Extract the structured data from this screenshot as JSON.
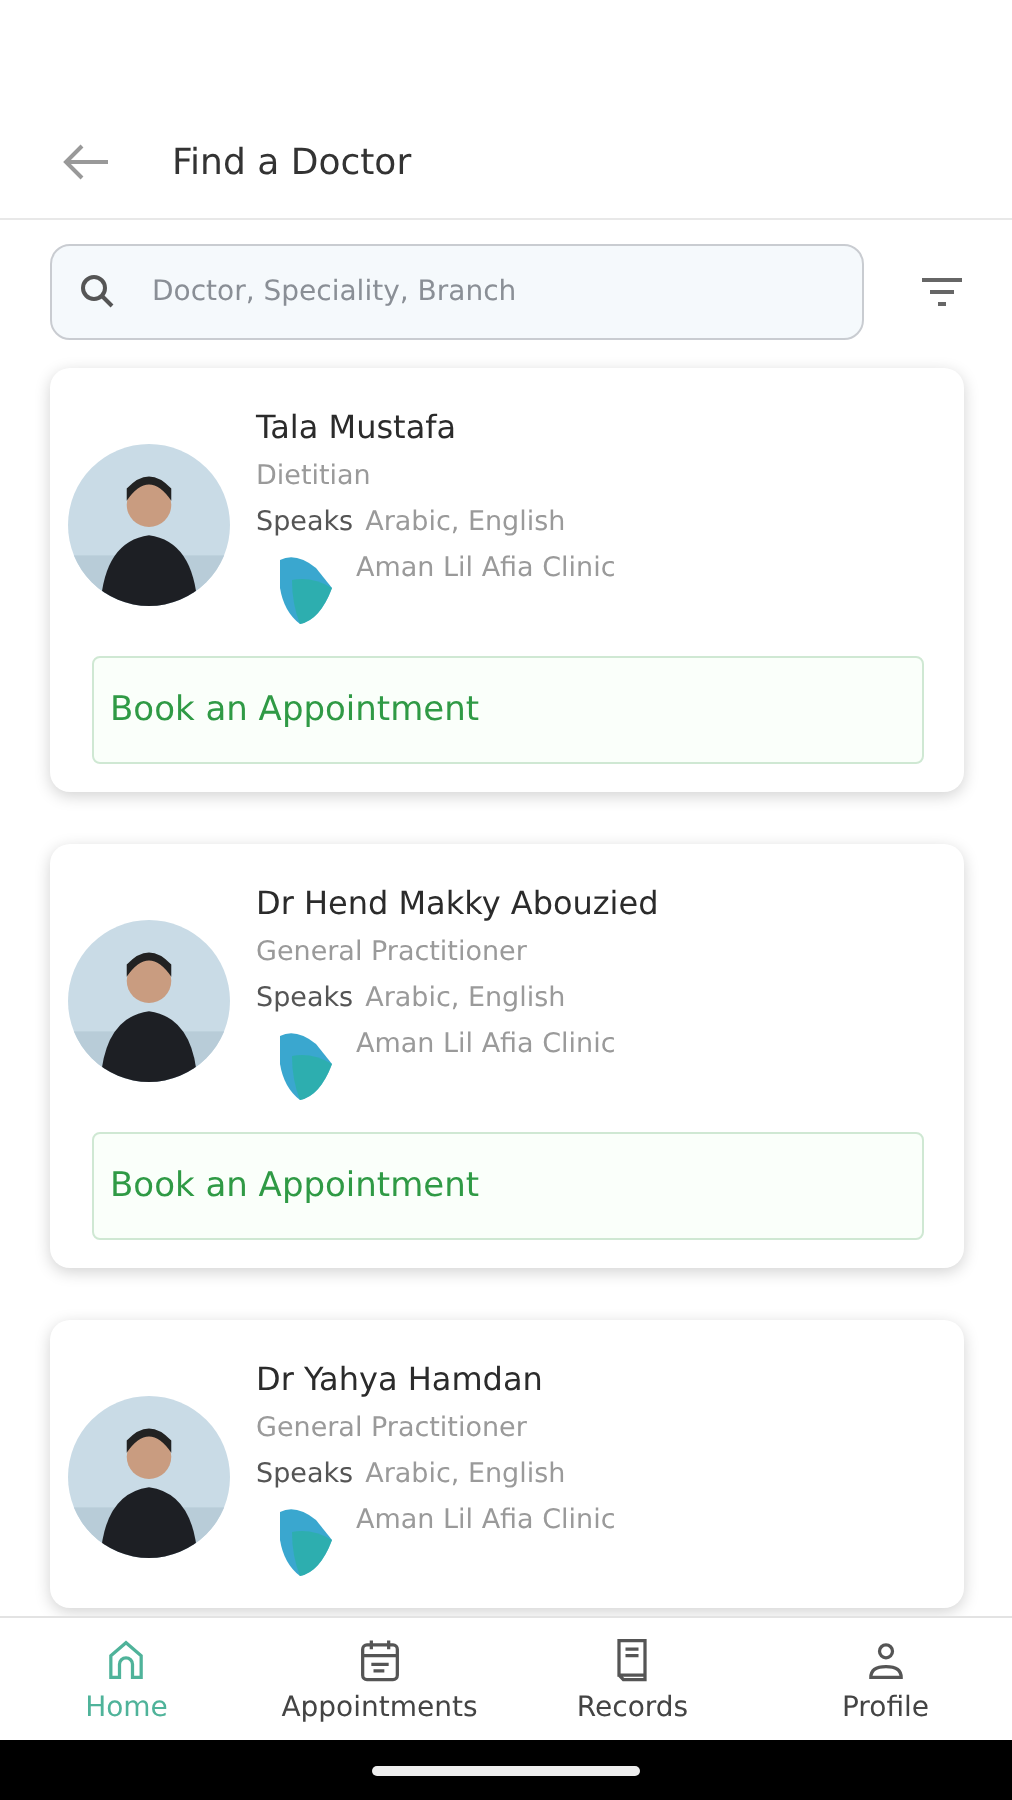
{
  "header": {
    "title": "Find a Doctor"
  },
  "search": {
    "placeholder": "Doctor, Speciality, Branch"
  },
  "doctors": [
    {
      "name": "Tala Mustafa",
      "specialty": "Dietitian",
      "speaks_label": "Speaks",
      "languages": "Arabic, English",
      "clinic": "Aman Lil Afia Clinic",
      "button": "Book an Appointment"
    },
    {
      "name": "Dr Hend Makky Abouzied",
      "specialty": "General Practitioner",
      "speaks_label": "Speaks",
      "languages": "Arabic, English",
      "clinic": "Aman Lil Afia Clinic",
      "button": "Book an Appointment"
    },
    {
      "name": "Dr Yahya Hamdan",
      "specialty": "General Practitioner",
      "speaks_label": "Speaks",
      "languages": "Arabic, English",
      "clinic": "Aman Lil Afia Clinic"
    }
  ],
  "nav": [
    {
      "label": "Home",
      "selected": true
    },
    {
      "label": "Appointments",
      "selected": false
    },
    {
      "label": "Records",
      "selected": false
    },
    {
      "label": "Profile",
      "selected": false
    }
  ]
}
